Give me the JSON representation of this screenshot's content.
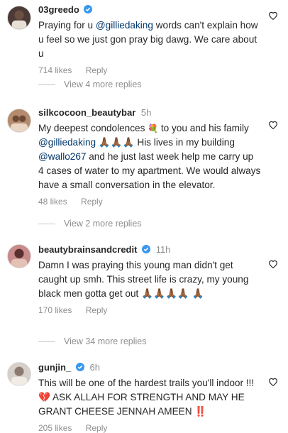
{
  "comments": [
    {
      "username": "03greedo",
      "verified": true,
      "time": "",
      "text": [
        "Praying for u ",
        "@gilliedaking",
        " words can't explain how u feel so we just gon pray big dawg. We care about u"
      ],
      "likes": "714 likes",
      "reply": "Reply"
    },
    {
      "username": "silkcocoon_beautybar",
      "verified": false,
      "time": "5h",
      "text": [
        "My deepest condolences ",
        "💐",
        " to you and his family ",
        "@gilliedaking",
        " 🙏🏾🙏🏾🙏🏾 His lives in my building ",
        "@wallo267",
        " and he just last week help me carry up 4 cases of water to my apartment. We would always have a small conversation in the elevator."
      ],
      "likes": "48 likes",
      "reply": "Reply"
    },
    {
      "username": "beautybrainsandcredit",
      "verified": true,
      "time": "11h",
      "text": [
        "Damn I was praying this young man didn't get caught up smh. This street life is crazy, my young black men gotta get out 🙏🏾🙏🏾🙏🏾🙏🏾 🙏🏾"
      ],
      "likes": "170 likes",
      "reply": "Reply"
    },
    {
      "username": "gunjin_",
      "verified": true,
      "time": "6h",
      "text": [
        "This will be one of the hardest trails you'll indoor !!!💔  ASK ALLAH FOR STRENGTH AND MAY HE GRANT CHEESE JENNAH AMEEN ‼️"
      ],
      "likes": "205 likes",
      "reply": "Reply"
    }
  ],
  "view_replies": [
    "View 4 more replies",
    "View 2 more replies",
    "View 34 more replies"
  ],
  "colors": {
    "text": "#262626",
    "muted": "#8e8e8e",
    "link": "#00376b",
    "verified": "#3897f0"
  },
  "icons": [
    "heart-icon",
    "verified-badge-icon",
    "avatar"
  ]
}
